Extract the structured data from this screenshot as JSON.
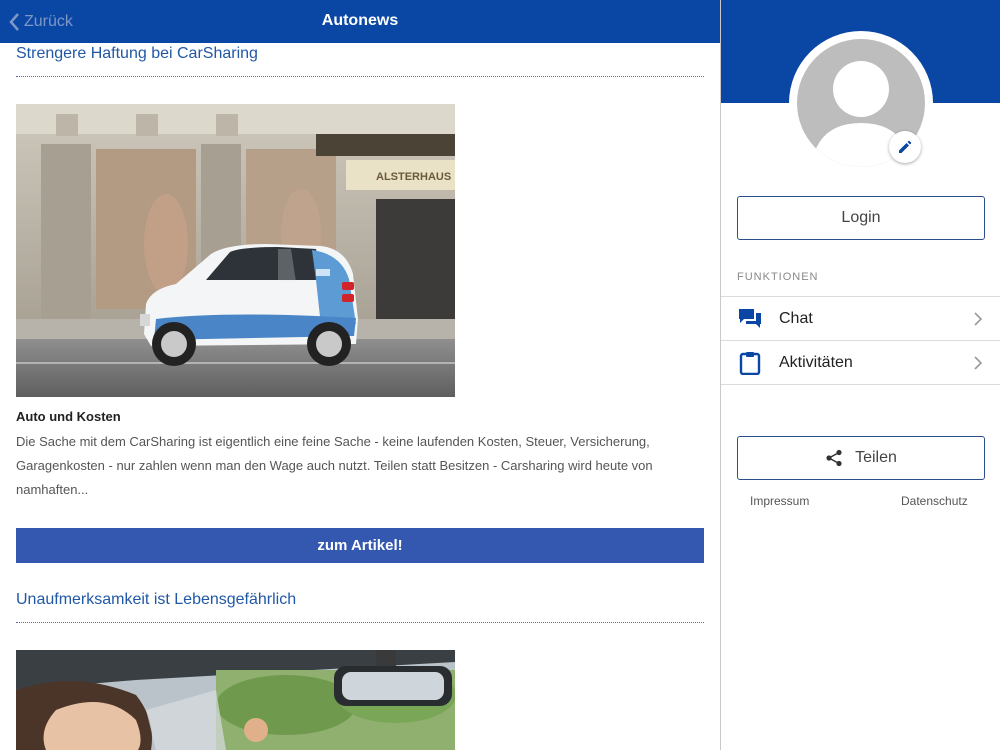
{
  "header": {
    "back_label": "Zurück",
    "title": "Autonews"
  },
  "articles": [
    {
      "title": "Strengere Haftung bei CarSharing",
      "subheading": "Auto und Kosten",
      "teaser": "Die Sache mit dem CarSharing ist eigentlich eine feine Sache - keine laufenden Kosten, Steuer, Versicherung, Garagenkosten - nur zahlen wenn man den Wage auch nutzt. Teilen statt Besitzen - Carsharing wird heute von namhaften...",
      "cta_label": "zum Artikel!",
      "storefront_sign": "ALSTERHAUS"
    },
    {
      "title": "Unaufmerksamkeit ist Lebensgefährlich"
    }
  ],
  "sidebar": {
    "login_label": "Login",
    "section_label": "FUNKTIONEN",
    "menu": [
      {
        "label": "Chat",
        "icon": "chat-icon"
      },
      {
        "label": "Aktivitäten",
        "icon": "clipboard-icon"
      }
    ],
    "share_label": "Teilen",
    "footer": {
      "impressum": "Impressum",
      "datenschutz": "Datenschutz"
    }
  },
  "colors": {
    "brand_blue": "#0a47a5",
    "button_blue": "#3457b0",
    "link_blue": "#2158a6"
  }
}
